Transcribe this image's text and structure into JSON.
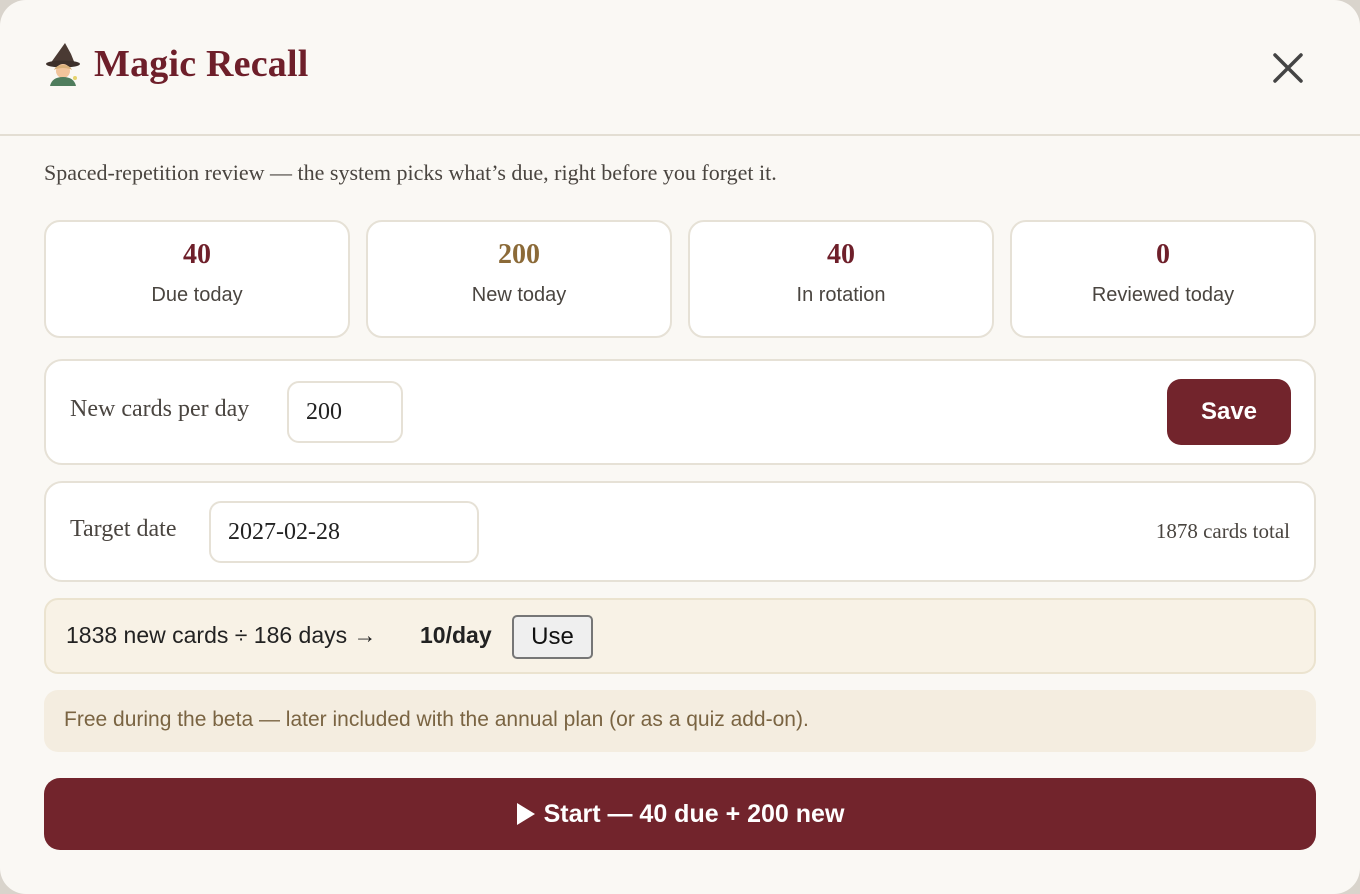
{
  "header": {
    "title": "Magic Recall",
    "icon": "wizard-icon",
    "close_icon": "close-icon"
  },
  "subtitle": "Spaced-repetition review — the system picks what’s due, right before you forget it.",
  "stats": [
    {
      "value": "40",
      "label": "Due today",
      "color": "#6e1f2a"
    },
    {
      "value": "200",
      "label": "New today",
      "color": "#8b6a38"
    },
    {
      "value": "40",
      "label": "In rotation",
      "color": "#6e1f2a"
    },
    {
      "value": "0",
      "label": "Reviewed today",
      "color": "#6e1f2a"
    }
  ],
  "new_cards": {
    "label": "New cards per day",
    "value": "200",
    "save_label": "Save"
  },
  "target": {
    "label": "Target date",
    "value": "2027-02-28",
    "total_text": "1878 cards total"
  },
  "calc": {
    "text": "1838 new cards ÷ 186 days →",
    "result": "10/day",
    "use_label": "Use"
  },
  "beta_note": "Free during the beta — later included with the annual plan (or as a quiz add-on).",
  "start": {
    "icon": "play-icon",
    "label": "Start — 40 due + 200 new"
  },
  "colors": {
    "accent": "#72242c",
    "title": "#6e1f2a",
    "new_stat": "#8b6a38",
    "note_bg": "#f4ede0"
  }
}
